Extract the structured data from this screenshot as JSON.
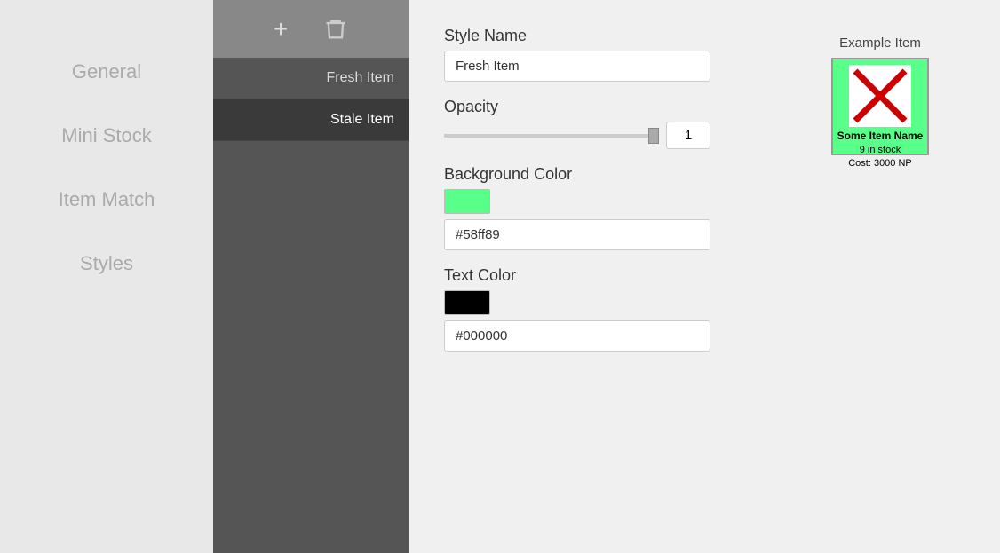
{
  "sidebar": {
    "items": [
      {
        "id": "general",
        "label": "General"
      },
      {
        "id": "mini-stock",
        "label": "Mini Stock"
      },
      {
        "id": "item-match",
        "label": "Item Match"
      },
      {
        "id": "styles",
        "label": "Styles"
      }
    ]
  },
  "toolbar": {
    "add_icon": "+",
    "delete_icon": "🗑"
  },
  "style_list": {
    "items": [
      {
        "id": "fresh-item",
        "label": "Fresh Item",
        "active": false
      },
      {
        "id": "stale-item",
        "label": "Stale Item",
        "active": true
      }
    ]
  },
  "form": {
    "style_name_label": "Style Name",
    "style_name_value": "Fresh Item",
    "opacity_label": "Opacity",
    "opacity_value": "1",
    "bg_color_label": "Background Color",
    "bg_color_hex": "#58ff89",
    "bg_color_swatch": "#58ff89",
    "text_color_label": "Text Color",
    "text_color_hex": "#000000",
    "text_color_swatch": "#000000"
  },
  "example": {
    "label": "Example Item",
    "item_name": "Some Item Name",
    "item_stock": "9 in stock",
    "item_cost": "Cost: 3000 NP",
    "bg_color": "#58ff89"
  }
}
